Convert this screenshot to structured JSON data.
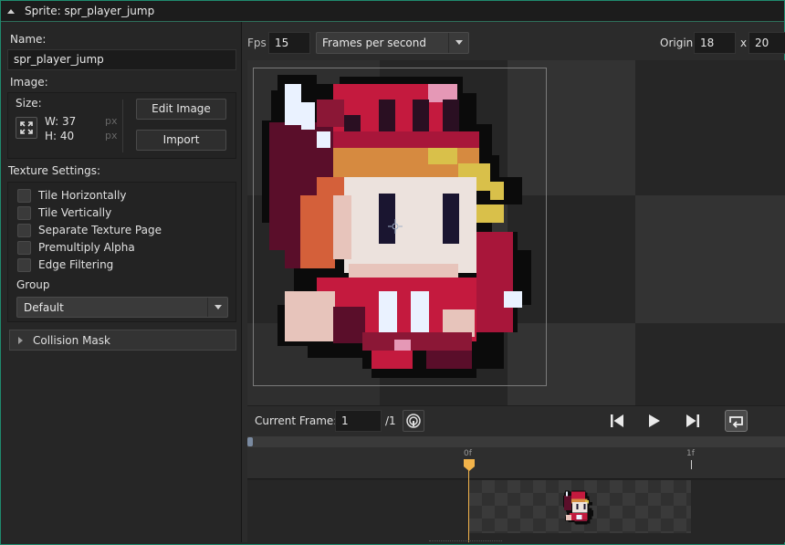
{
  "window": {
    "title": "Sprite: spr_player_jump"
  },
  "left_panel": {
    "name_label": "Name:",
    "name_value": "spr_player_jump",
    "image_label": "Image:",
    "size_label": "Size:",
    "width_text": "W: 37",
    "height_text": "H: 40",
    "unit_px": "px",
    "edit_image_label": "Edit Image",
    "import_label": "Import",
    "texture_settings_label": "Texture Settings:",
    "checkboxes": [
      {
        "label": "Tile Horizontally",
        "checked": false
      },
      {
        "label": "Tile Vertically",
        "checked": false
      },
      {
        "label": "Separate Texture Page",
        "checked": false
      },
      {
        "label": "Premultiply Alpha",
        "checked": false
      },
      {
        "label": "Edge Filtering",
        "checked": false
      }
    ],
    "group_label": "Group",
    "group_value": "Default",
    "collision_mask_label": "Collision Mask"
  },
  "toolbar": {
    "fps_label": "Fps",
    "fps_value": "15",
    "speed_mode": "Frames per second",
    "origin_label": "Origin",
    "origin_x": "18",
    "origin_sep": "x",
    "origin_y": "20"
  },
  "playback": {
    "current_frame_label": "Current Frame:",
    "current_frame_value": "1",
    "frame_total": "/1"
  },
  "timeline": {
    "markers": [
      "0f",
      "1f"
    ]
  },
  "colors": {
    "accent_green": "#1f8a6e",
    "playhead": "#f2b34a",
    "checker_dark": "#262626",
    "checker_light": "#333333"
  }
}
